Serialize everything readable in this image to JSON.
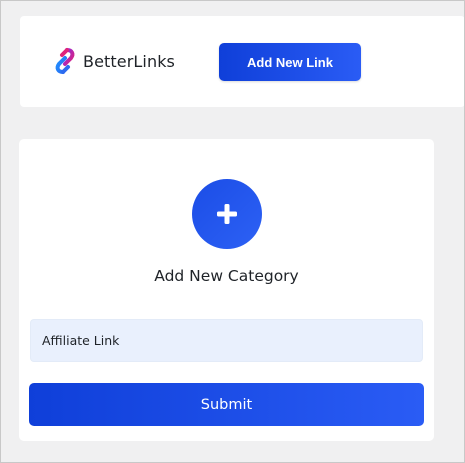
{
  "header": {
    "brand_name": "BetterLinks",
    "add_new_link_label": "Add New Link"
  },
  "category_panel": {
    "add_icon": "plus-icon",
    "title": "Add New Category",
    "input_value": "Affiliate Link",
    "submit_label": "Submit"
  },
  "colors": {
    "primary": "#1e50eb",
    "input_background": "#e9f0fd",
    "page_background": "#f0f0f1",
    "logo_blue": "#2d6bf0",
    "logo_pink": "#e0247a"
  }
}
